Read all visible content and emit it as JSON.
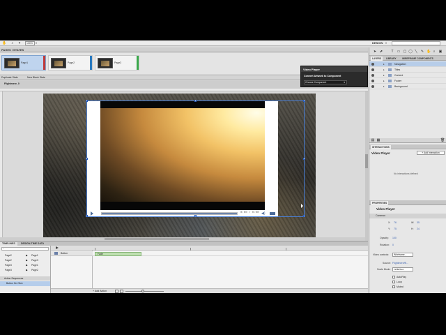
{
  "toolbar": {
    "zoom": "100%",
    "mode": "DESIGN"
  },
  "pages": {
    "header": "PAGES / STATES",
    "items": [
      {
        "label": "Page1",
        "color": "#c03a3a"
      },
      {
        "label": "Page2",
        "color": "#2a7ac0"
      },
      {
        "label": "Page3",
        "color": "#3aa84a"
      }
    ],
    "duplicate_state": "Duplicate State",
    "new_blank_state": "New Blank State"
  },
  "document": {
    "name": "Flightmere_0"
  },
  "video_player": {
    "time": "0:00 / 0:00"
  },
  "popup": {
    "title": "Video Player",
    "subtitle": "Convert Artwork to Component",
    "choose": "Choose Component"
  },
  "timelines": {
    "tabs": [
      "TIMELINES",
      "DESIGN-TIME DATA"
    ],
    "search_placeholder": "",
    "rows": [
      {
        "from": "Page2",
        "to": "Page1"
      },
      {
        "from": "Page2",
        "to": "Page3"
      },
      {
        "from": "Page3",
        "to": "Page1"
      },
      {
        "from": "Page3",
        "to": "Page2"
      }
    ],
    "section": "Action Sequences",
    "action": "Button On Click",
    "layer": "Button",
    "fade": "Fade",
    "add_action": "Add Action"
  },
  "right_panel": {
    "tabs": [
      "LAYERS",
      "LIBRARY",
      "WIREFRAME COMPONENTS"
    ],
    "layers": [
      "Navigation",
      "Titles",
      "Content",
      "Footer",
      "Background"
    ],
    "interactions_tab": "INTERACTIONS",
    "interactions_title": "Video Player",
    "add_interaction": "Add Interaction",
    "no_interactions": "No interactions defined",
    "properties_tab": "PROPERTIES",
    "properties_title": "Video Player",
    "common": "Common",
    "x_label": "X:",
    "x_value": "76",
    "w_label": "W:",
    "w_value": "35",
    "y_label": "Y:",
    "y_value": "75",
    "h_label": "H:",
    "h_value": "24",
    "opacity_label": "Opacity:",
    "opacity_value": "100",
    "rotation_label": "Rotation:",
    "rotation_value": "0",
    "video_controls_label": "Video controls:",
    "video_controls_value": "Wireframe...",
    "source_label": "Source:",
    "source_value": "Flightmere/fli...",
    "scale_mode_label": "Scale Mode:",
    "scale_mode_value": "Letterbox",
    "checkboxes": [
      "AutoPlay",
      "Loop",
      "Muted"
    ]
  }
}
